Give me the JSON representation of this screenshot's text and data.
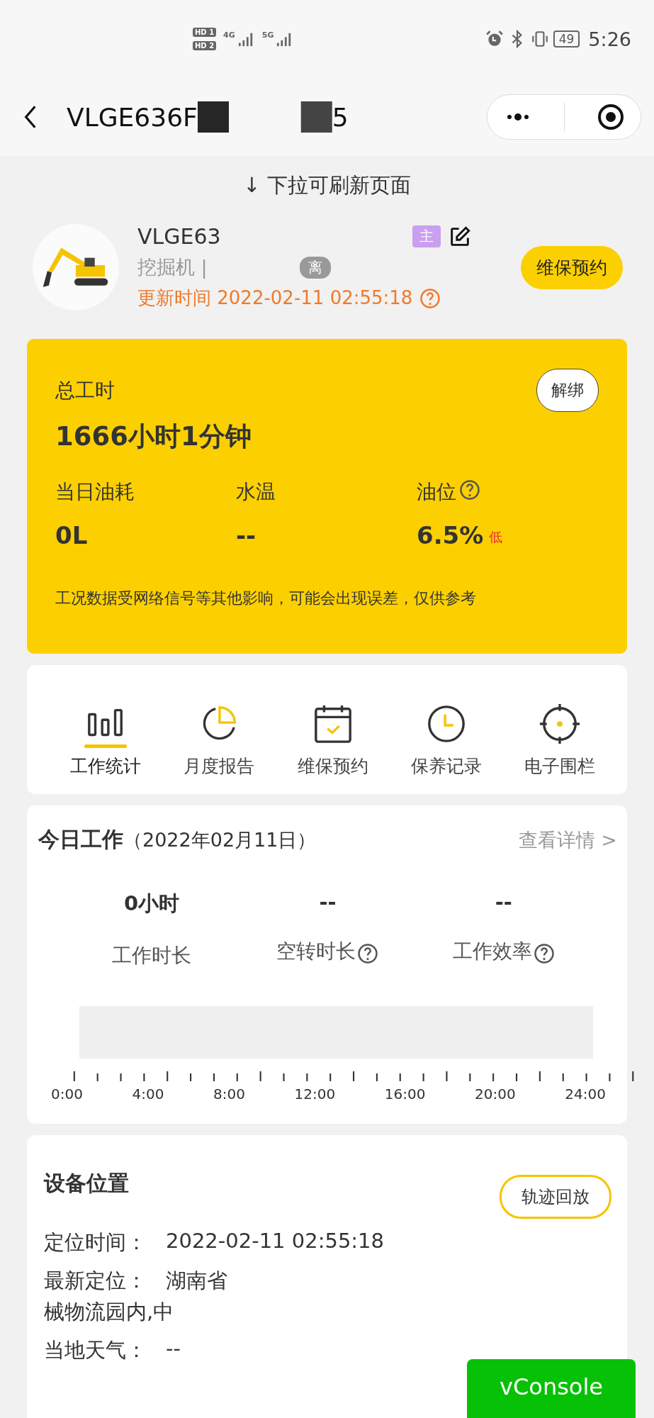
{
  "status_bar": {
    "sim_labels": [
      "HD 1",
      "HD 2"
    ],
    "networks": [
      "4G",
      "5G"
    ],
    "battery": "49",
    "time": "5:26"
  },
  "nav": {
    "title": "VLGE636F",
    "title_tail": "5"
  },
  "pull_hint": "↓ 下拉可刷新页面",
  "device": {
    "name": "VLGE63",
    "type": "挖掘机 |",
    "status_badge": "离",
    "owner_badge": "主",
    "updated": "更新时间 2022-02-11 02:55:18",
    "button": "维保预约"
  },
  "summary": {
    "total_label": "总工时",
    "total_value": "1666小时1分钟",
    "unbind_button": "解绑",
    "metrics": [
      {
        "label": "当日油耗",
        "value": "0L",
        "help": false
      },
      {
        "label": "水温",
        "value": "--",
        "help": false
      },
      {
        "label": "油位",
        "value": "6.5%",
        "help": true,
        "flag": "低"
      }
    ],
    "note": "工况数据受网络信号等其他影响，可能会出现误差，仅供参考"
  },
  "shortcuts": [
    {
      "kind": "stats",
      "label": "工作统计",
      "selected": true
    },
    {
      "kind": "pie",
      "label": "月度报告",
      "selected": false
    },
    {
      "kind": "calendar",
      "label": "维保预约",
      "selected": false
    },
    {
      "kind": "clock",
      "label": "保养记录",
      "selected": false
    },
    {
      "kind": "target",
      "label": "电子围栏",
      "selected": false
    }
  ],
  "today": {
    "title": "今日工作",
    "date": "（2022年02月11日）",
    "link": "查看详情 >",
    "stats": [
      {
        "value": "0小时",
        "label": "工作时长",
        "help": false
      },
      {
        "value": "--",
        "label": "空转时长",
        "help": true
      },
      {
        "value": "--",
        "label": "工作效率",
        "help": true
      }
    ],
    "timeline_ticks": [
      "0:00",
      "4:00",
      "8:00",
      "12:00",
      "16:00",
      "20:00",
      "24:00"
    ]
  },
  "location": {
    "title": "设备位置",
    "button": "轨迹回放",
    "rows": [
      {
        "label": "定位时间：",
        "value": "2022-02-11 02:55:18"
      },
      {
        "label": "最新定位：",
        "value": "湖南省",
        "more_lines": [
          "械物流园内,中"
        ]
      },
      {
        "label": "当地天气：",
        "value": "--"
      }
    ]
  },
  "console_button": "vConsole"
}
